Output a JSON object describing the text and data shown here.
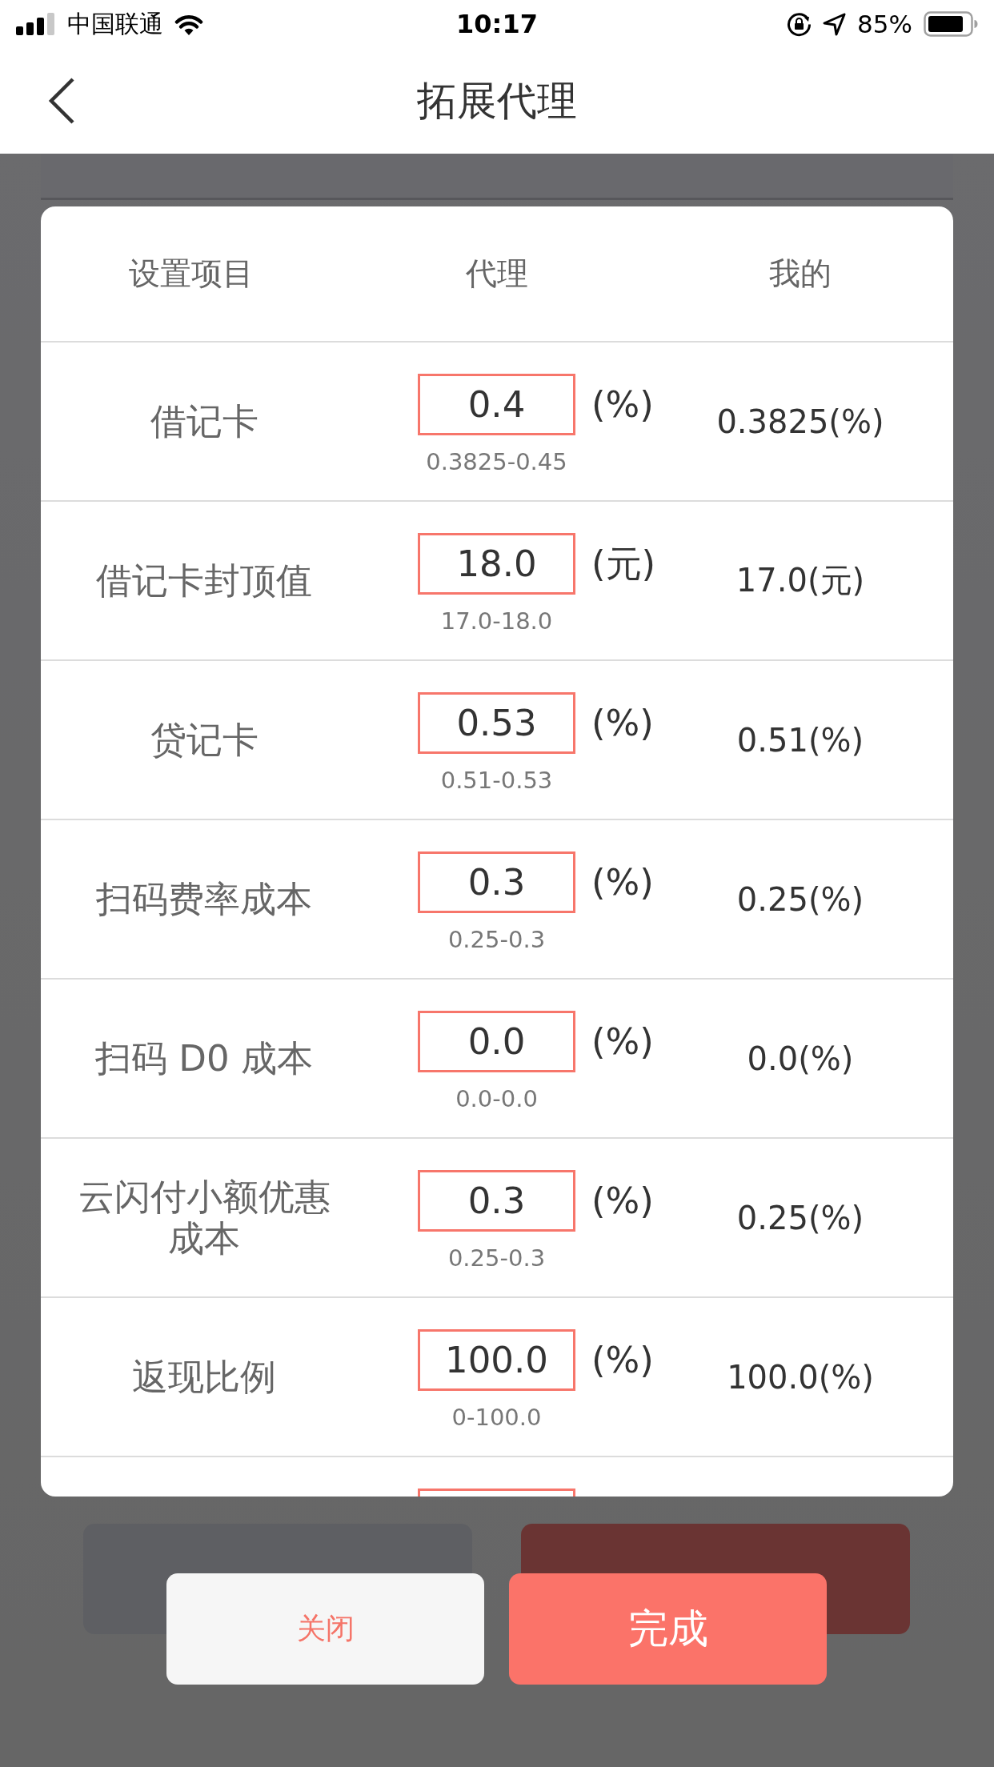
{
  "status_bar": {
    "carrier": "中国联通",
    "time": "10:17",
    "battery": "85%"
  },
  "nav": {
    "title": "拓展代理"
  },
  "page_buttons": [
    {
      "kind": "neutral"
    },
    {
      "kind": "primary"
    }
  ],
  "table": {
    "columns": [
      "设置项目",
      "代理",
      "我的"
    ],
    "rows": [
      {
        "item": "借记卡",
        "value": "0.4",
        "unit": "(%)",
        "range": "0.3825-0.45",
        "mine": "0.3825(%)"
      },
      {
        "item": "借记卡封顶值",
        "value": "18.0",
        "unit": "(元)",
        "range": "17.0-18.0",
        "mine": "17.0(元)"
      },
      {
        "item": "贷记卡",
        "value": "0.53",
        "unit": "(%)",
        "range": "0.51-0.53",
        "mine": "0.51(%)"
      },
      {
        "item": "扫码费率成本",
        "value": "0.3",
        "unit": "(%)",
        "range": "0.25-0.3",
        "mine": "0.25(%)"
      },
      {
        "item": "扫码 D0 成本",
        "value": "0.0",
        "unit": "(%)",
        "range": "0.0-0.0",
        "mine": "0.0(%)"
      },
      {
        "item": "云闪付小额优惠成本",
        "value": "0.3",
        "unit": "(%)",
        "range": "0.25-0.3",
        "mine": "0.25(%)"
      },
      {
        "item": "返现比例",
        "value": "100.0",
        "unit": "(%)",
        "range": "0-100.0",
        "mine": "100.0(%)"
      }
    ],
    "clipped_row_field": true
  },
  "dialog_buttons": [
    {
      "label": "关闭",
      "kind": "secondary"
    },
    {
      "label": "完成",
      "kind": "primary"
    }
  ]
}
